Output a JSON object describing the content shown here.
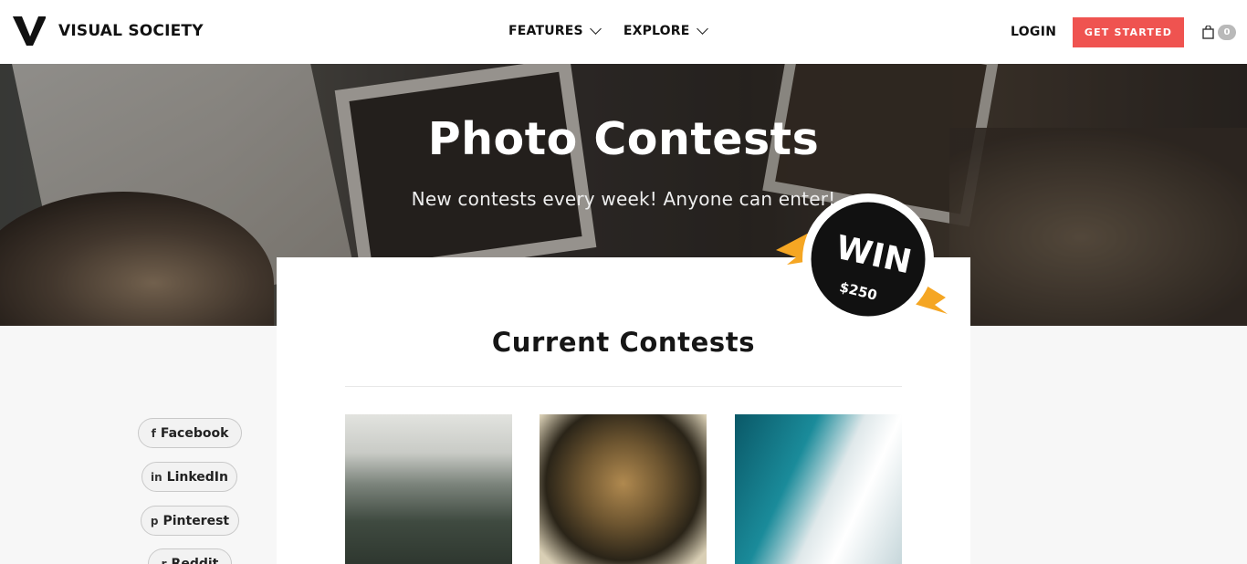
{
  "header": {
    "brand": "VISUAL SOCIETY",
    "nav": [
      {
        "label": "FEATURES",
        "icon": "chevron-down-icon"
      },
      {
        "label": "EXPLORE",
        "icon": "chevron-down-icon"
      }
    ],
    "login": "LOGIN",
    "cta": "GET STARTED",
    "cart_count": "0"
  },
  "hero": {
    "title": "Photo Contests",
    "subtitle": "New contests every week! Anyone can enter!",
    "badge_main": "WIN",
    "badge_amount": "$250"
  },
  "main": {
    "title": "Current Contests"
  },
  "share": [
    {
      "label": "Facebook",
      "icon": "f"
    },
    {
      "label": "LinkedIn",
      "icon": "in"
    },
    {
      "label": "Pinterest",
      "icon": "p"
    },
    {
      "label": "Reddit",
      "icon": "r"
    }
  ],
  "colors": {
    "accent": "#ef5350",
    "badge": "#111111",
    "ribbon": "#f5b833"
  }
}
